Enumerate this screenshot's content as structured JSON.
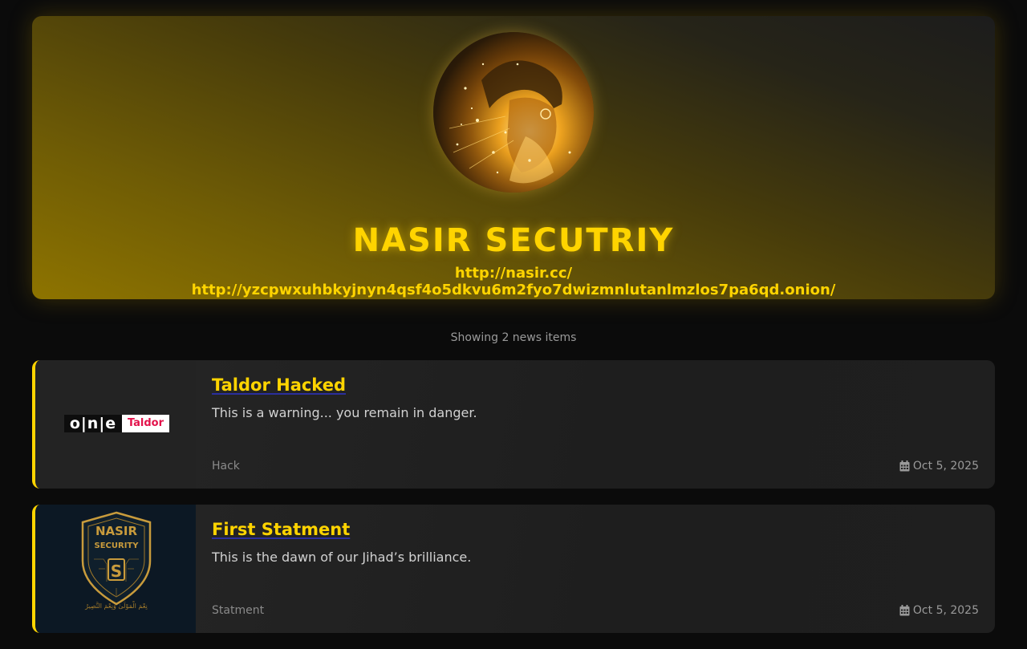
{
  "header": {
    "title": "NASIR SECUTRIY",
    "link_clearnet": "http://nasir.cc/",
    "link_onion": "http://yzcpwxuhbkyjnyn4qsf4o5dkvu6m2fyo7dwizmnlutanlmzlos7pa6qd.onion/"
  },
  "listing": {
    "count_text": "Showing 2 news items"
  },
  "news": [
    {
      "title": "Taldor Hacked",
      "description": "This is a warning... you remain in danger.",
      "category": "Hack",
      "date": "Oct 5, 2025",
      "thumbnail": {
        "logo_left": "o|n|e",
        "logo_right": "Taldor"
      }
    },
    {
      "title": "First Statment",
      "description": "This is the dawn of our Jihad’s brilliance.",
      "category": "Statment",
      "date": "Oct 5, 2025",
      "thumbnail": {
        "line1": "NASIR",
        "line2": "SECURITY",
        "letter": "S",
        "arabic": "نِعْمَ الْمَوْلَىٰ وَنِعْمَ النَّصِيرُ"
      }
    }
  ],
  "colors": {
    "accent": "#ffd400",
    "background": "#0b0b0b",
    "card": "#1f1f1f",
    "taldor_red": "#e3124b"
  },
  "icons": {
    "date": "calendar-icon"
  }
}
